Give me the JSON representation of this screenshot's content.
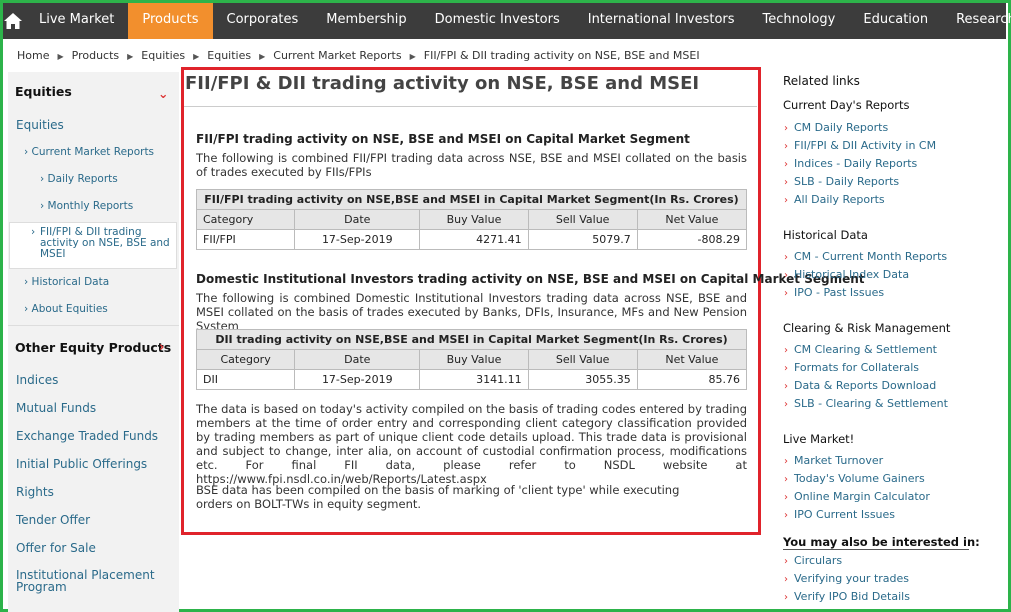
{
  "nav": {
    "items": [
      "Live Market",
      "Products",
      "Corporates",
      "Membership",
      "Domestic Investors",
      "International Investors",
      "Technology",
      "Education",
      "Research"
    ],
    "active": "Products",
    "accent_color": "#f28f2d",
    "home_icon": "home-icon"
  },
  "breadcrumb": [
    "Home",
    "Products",
    "Equities",
    "Equities",
    "Current Market Reports",
    "FII/FPI & DII trading activity on NSE, BSE and MSEI"
  ],
  "sidebar": {
    "heading": "Equities",
    "sub_heading": "Equities",
    "sub_items": [
      "Current Market Reports",
      "Daily Reports",
      "Monthly Reports",
      "FII/FPI & DII trading activity on NSE, BSE and MSEI",
      "Historical Data",
      "About Equities"
    ],
    "other_heading": "Other Equity Products",
    "other_items": [
      "Indices",
      "Mutual Funds",
      "Exchange Traded Funds",
      "Initial Public Offerings",
      "Rights",
      "Tender Offer",
      "Offer for Sale",
      "Institutional Placement Program"
    ]
  },
  "main": {
    "title": "FII/FPI & DII trading activity on NSE, BSE and MSEI",
    "fii": {
      "heading": "FII/FPI trading activity on NSE, BSE and MSEI on Capital Market Segment",
      "description": "The following is combined FII/FPI trading data across NSE, BSE and MSEI collated on the basis of trades executed by FIIs/FPIs",
      "table_caption": "FII/FPI trading activity on NSE,BSE and MSEI in Capital Market Segment(In Rs. Crores)",
      "columns": [
        "Category",
        "Date",
        "Buy Value",
        "Sell Value",
        "Net Value"
      ],
      "row": {
        "category": "FII/FPI",
        "date": "17-Sep-2019",
        "buy": "4271.41",
        "sell": "5079.7",
        "net": "-808.29"
      }
    },
    "dii": {
      "heading": "Domestic Institutional Investors trading activity on NSE, BSE and MSEI on Capital Market Segment",
      "description": "The following is combined Domestic Institutional Investors trading data across NSE, BSE and MSEI collated on the basis of trades executed by Banks, DFIs, Insurance, MFs and New Pension System",
      "table_caption": "DII trading activity on NSE,BSE and MSEI in Capital Market Segment(In Rs. Crores)",
      "columns": [
        "Category",
        "Date",
        "Buy Value",
        "Sell Value",
        "Net Value"
      ],
      "row": {
        "category": "DII",
        "date": "17-Sep-2019",
        "buy": "3141.11",
        "sell": "3055.35",
        "net": "85.76"
      }
    },
    "note1": "The data is based on today's activity compiled on the basis of trading codes entered by trading members at the time of order entry and corresponding client category classification provided by trading members as part of unique client code details upload. This trade data is provisional and subject to change, inter alia, on account of custodial confirmation process, modifications etc. For final FII data, please refer to NSDL website at https://www.fpi.nsdl.co.in/web/Reports/Latest.aspx",
    "note2_line1": "BSE data has been compiled on the basis of marking of 'client type' while executing",
    "note2_line2": "orders on BOLT-TWs in equity segment."
  },
  "related": {
    "heading": "Related links",
    "groups": [
      {
        "title": "Current Day's Reports",
        "links": [
          "CM Daily Reports",
          "FII/FPI & DII Activity in CM",
          "Indices - Daily Reports",
          "SLB - Daily Reports",
          "All Daily Reports"
        ]
      },
      {
        "title": "Historical Data",
        "links": [
          "CM - Current Month Reports",
          "Historical Index Data",
          "IPO - Past Issues"
        ]
      },
      {
        "title": "Clearing & Risk Management",
        "links": [
          "CM Clearing & Settlement",
          "Formats for Collaterals",
          "Data & Reports Download",
          "SLB - Clearing & Settlement"
        ]
      },
      {
        "title": "Live Market!",
        "links": [
          "Market Turnover",
          "Today's Volume Gainers",
          "Online Margin Calculator",
          "IPO Current Issues"
        ]
      }
    ],
    "interest_heading": "You may also be interested in:",
    "interest_links": [
      "Circulars",
      "Verifying your trades",
      "Verify IPO Bid Details"
    ]
  }
}
